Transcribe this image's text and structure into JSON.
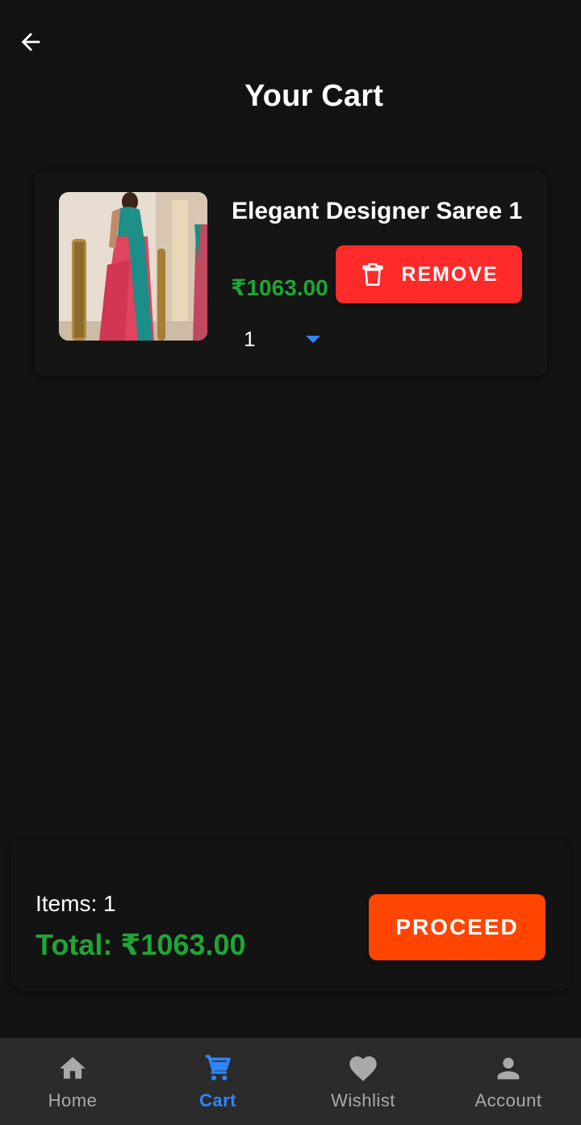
{
  "header": {
    "title": "Your Cart"
  },
  "cart": {
    "items": [
      {
        "name": "Elegant Designer Saree 1",
        "price": "₹1063.00",
        "quantity": "1",
        "remove_label": "REMOVE",
        "image": "saree-photo"
      }
    ]
  },
  "summary": {
    "items_label": "Items: 1",
    "total_label": "Total: ₹1063.00",
    "proceed_label": "PROCEED"
  },
  "nav": [
    {
      "label": "Home",
      "icon": "home-icon",
      "active": false
    },
    {
      "label": "Cart",
      "icon": "cart-icon",
      "active": true
    },
    {
      "label": "Wishlist",
      "icon": "heart-icon",
      "active": false
    },
    {
      "label": "Account",
      "icon": "account-icon",
      "active": false
    }
  ],
  "colors": {
    "background": "#121212",
    "price_green": "#1fa535",
    "remove_red": "#ff2a2a",
    "proceed_orange": "#ff4500",
    "active_blue": "#2e86ff",
    "nav_inactive": "#a9a9a9",
    "nav_bar": "#2b2b2b"
  }
}
